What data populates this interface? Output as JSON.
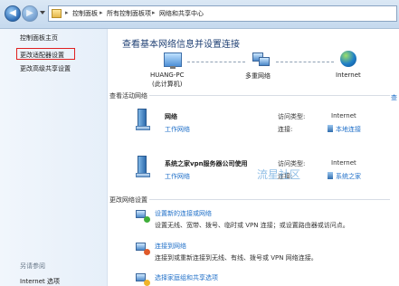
{
  "breadcrumb": {
    "items": [
      "控制面板",
      "所有控制面板项",
      "网络和共享中心"
    ]
  },
  "sidebar": {
    "items": [
      {
        "label": "控制面板主页"
      },
      {
        "label": "更改适配器设置"
      },
      {
        "label": "更改高级共享设置"
      }
    ],
    "see_also": "另请参阅",
    "ie_options": "Internet 选项"
  },
  "main": {
    "title": "查看基本网络信息并设置连接",
    "map": {
      "pc_name": "HUANG-PC",
      "pc_sub": "(此计算机)",
      "network": "多重网络",
      "internet": "Internet",
      "edge_text": "查"
    },
    "active_label": "查看活动网络",
    "networks": [
      {
        "name": "网络",
        "type": "工作网络",
        "access_label": "访问类型:",
        "access_value": "Internet",
        "conn_label": "连接:",
        "conn_value": "本地连接"
      },
      {
        "name": "系统之家vpn服务器公司使用",
        "type": "工作网络",
        "access_label": "访问类型:",
        "access_value": "Internet",
        "conn_label": "连接:",
        "conn_value": "系统之家"
      }
    ],
    "change_label": "更改网络设置",
    "tasks": [
      {
        "title": "设置新的连接或网络",
        "desc": "设置无线、宽带、拨号、临时或 VPN 连接；或设置路由器或访问点。"
      },
      {
        "title": "连接到网络",
        "desc": "连接到或重新连接到无线、有线、拨号或 VPN 网络连接。"
      },
      {
        "title": "选择家庭组和共享选项"
      }
    ],
    "watermark": "流星社区"
  }
}
